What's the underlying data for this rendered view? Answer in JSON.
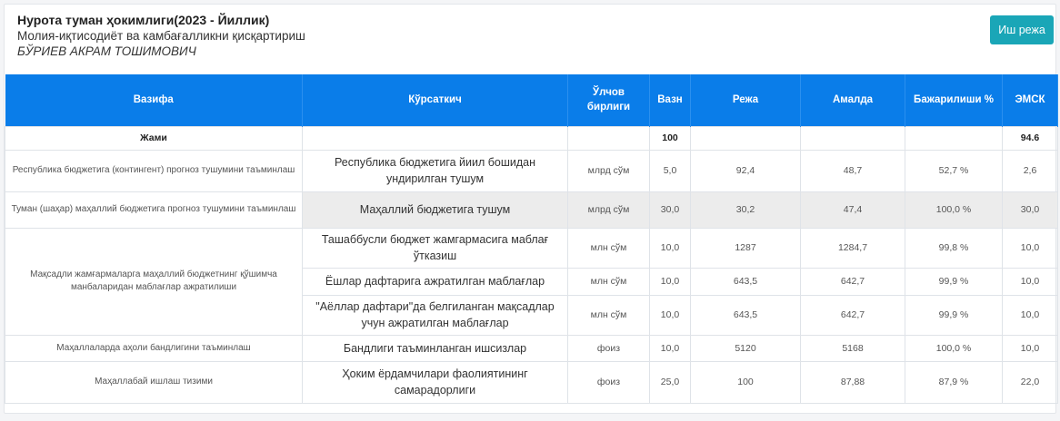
{
  "header": {
    "title": "Нурота туман ҳокимлиги(2023 - Йиллик)",
    "subtitle": "Молия-иқтисодиёт ва камбағалликни қисқартириш",
    "person": "БЎРИЕВ АКРАМ ТОШИМОВИЧ",
    "plan_button": "Иш режа"
  },
  "table": {
    "columns": [
      "Вазифа",
      "Кўрсаткич",
      "Ўлчов бирлиги",
      "Вазн",
      "Режа",
      "Амалда",
      "Бажарилиши %",
      "ЭМСК"
    ],
    "total": {
      "label": "Жами",
      "weight": "100",
      "emsk": "94.6"
    },
    "tasks": [
      "Республика бюджетига (контингент) прогноз тушумини таъминлаш",
      "Туман (шаҳар) маҳаллий бюджетига прогноз тушумини таъминлаш",
      "Мақсадли жамғармаларга маҳаллий бюджетнинг қўшимча манбаларидан маблағлар ажратилиши",
      "Маҳаллаларда аҳоли бандлигини таъминлаш",
      "Маҳаллабай ишлаш тизими"
    ],
    "rows": [
      {
        "indicator": "Республика бюджетига йиил бошидан ундирилган тушум",
        "unit": "млрд сўм",
        "weight": "5,0",
        "plan": "92,4",
        "actual": "48,7",
        "percent": "52,7 %",
        "emsk": "2,6"
      },
      {
        "indicator": "Маҳаллий бюджетига тушум",
        "unit": "млрд сўм",
        "weight": "30,0",
        "plan": "30,2",
        "actual": "47,4",
        "percent": "100,0 %",
        "emsk": "30,0"
      },
      {
        "indicator": "Ташаббусли бюджет жамгармасига маблағ ўтказиш",
        "unit": "млн сўм",
        "weight": "10,0",
        "plan": "1287",
        "actual": "1284,7",
        "percent": "99,8 %",
        "emsk": "10,0"
      },
      {
        "indicator": "Ёшлар дафтарига ажратилган маблағлар",
        "unit": "млн сўм",
        "weight": "10,0",
        "plan": "643,5",
        "actual": "642,7",
        "percent": "99,9 %",
        "emsk": "10,0"
      },
      {
        "indicator": "\"Аёллар дафтари\"да белгиланган мақсадлар учун ажратилган маблағлар",
        "unit": "млн сўм",
        "weight": "10,0",
        "plan": "643,5",
        "actual": "642,7",
        "percent": "99,9 %",
        "emsk": "10,0"
      },
      {
        "indicator": "Бандлиги таъминланган ишсизлар",
        "unit": "фоиз",
        "weight": "10,0",
        "plan": "5120",
        "actual": "5168",
        "percent": "100,0 %",
        "emsk": "10,0"
      },
      {
        "indicator": "Ҳоким ёрдамчилари фаолиятининг самарадорлиги",
        "unit": "фоиз",
        "weight": "25,0",
        "plan": "100",
        "actual": "87,88",
        "percent": "87,9 %",
        "emsk": "22,0"
      }
    ]
  }
}
